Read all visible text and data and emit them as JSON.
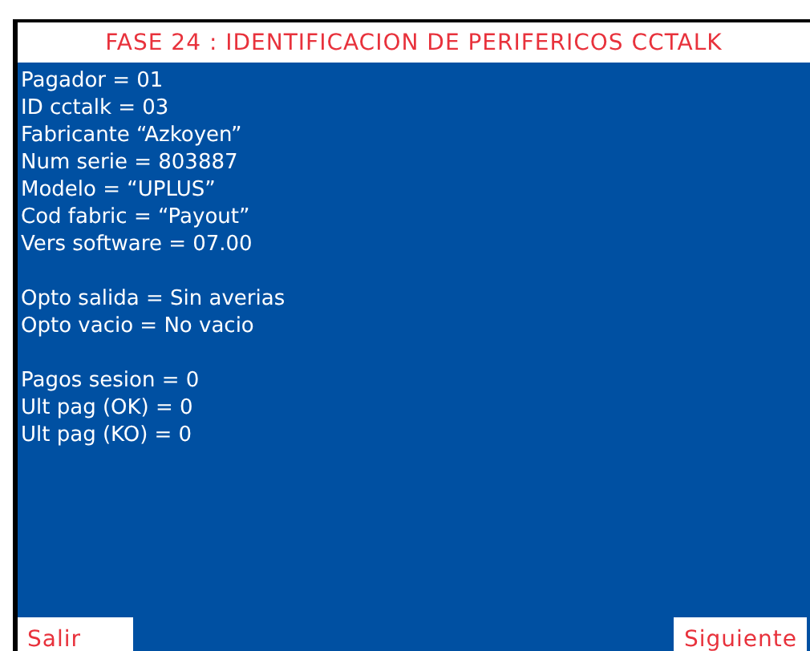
{
  "title": "FASE 24 : IDENTIFICACION DE PERIFERICOS CCTALK",
  "groups": [
    [
      "Pagador = 01",
      "ID cctalk = 03",
      "Fabricante “Azkoyen”",
      "Num serie = 803887",
      "Modelo = “UPLUS”",
      "Cod fabric = “Payout”",
      "Vers software = 07.00"
    ],
    [
      "Opto salida = Sin averias",
      "Opto vacio = No vacio"
    ],
    [
      "Pagos sesion = 0",
      "Ult pag (OK) = 0",
      "Ult pag (KO) = 0"
    ]
  ],
  "buttons": [
    "Salir",
    "Siguiente"
  ]
}
